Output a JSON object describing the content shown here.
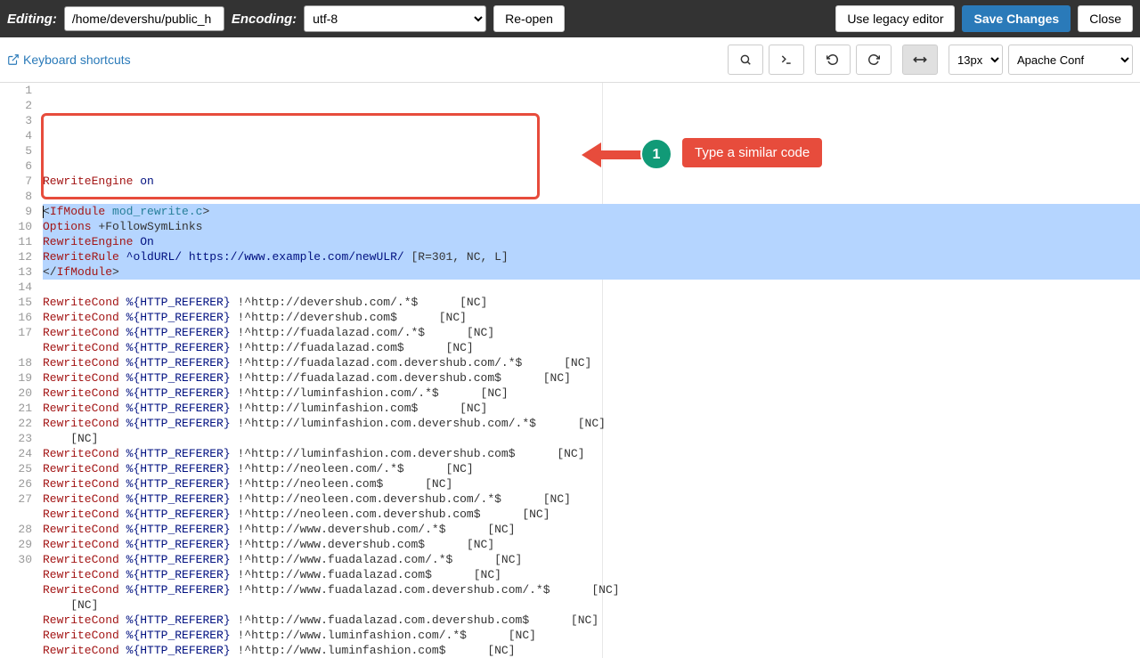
{
  "topbar": {
    "editing_label": "Editing:",
    "path": "/home/devershu/public_h",
    "encoding_label": "Encoding:",
    "encoding_value": "utf-8",
    "reopen": "Re-open",
    "legacy": "Use legacy editor",
    "save": "Save Changes",
    "close": "Close"
  },
  "toolbar": {
    "shortcuts": "Keyboard shortcuts",
    "fontsize": "13px",
    "syntax": "Apache Conf"
  },
  "annotation": {
    "number": "1",
    "text": "Type a similar code"
  },
  "code": {
    "lines": [
      {
        "n": 1,
        "sel": false,
        "tokens": [
          [
            "kw",
            "RewriteEngine"
          ],
          [
            "txt",
            " "
          ],
          [
            "val",
            "on"
          ]
        ]
      },
      {
        "n": 2,
        "sel": false,
        "tokens": []
      },
      {
        "n": 3,
        "sel": true,
        "tokens": [
          [
            "txt",
            "<"
          ],
          [
            "kw",
            "IfModule"
          ],
          [
            "txt",
            " "
          ],
          [
            "func",
            "mod_rewrite.c"
          ],
          [
            "txt",
            ">"
          ]
        ],
        "cursor": true
      },
      {
        "n": 4,
        "sel": true,
        "tokens": [
          [
            "kw",
            "Options"
          ],
          [
            "txt",
            " +FollowSymLinks"
          ]
        ]
      },
      {
        "n": 5,
        "sel": true,
        "tokens": [
          [
            "kw",
            "RewriteEngine"
          ],
          [
            "txt",
            " "
          ],
          [
            "val",
            "On"
          ]
        ]
      },
      {
        "n": 6,
        "sel": true,
        "tokens": [
          [
            "kw",
            "RewriteRule"
          ],
          [
            "txt",
            " "
          ],
          [
            "val",
            "^oldURL/ https://www.example.com/newULR/"
          ],
          [
            "txt",
            " [R=301, NC, L]"
          ]
        ]
      },
      {
        "n": 7,
        "sel": true,
        "tokens": [
          [
            "txt",
            "</"
          ],
          [
            "kw",
            "IfModule"
          ],
          [
            "txt",
            ">"
          ]
        ]
      },
      {
        "n": 8,
        "sel": false,
        "tokens": []
      },
      {
        "n": 9,
        "sel": false,
        "tokens": [
          [
            "kw",
            "RewriteCond"
          ],
          [
            "txt",
            " "
          ],
          [
            "val",
            "%{HTTP_REFERER}"
          ],
          [
            "txt",
            " !^http://devershub.com/.*$      [NC]"
          ]
        ]
      },
      {
        "n": 10,
        "sel": false,
        "tokens": [
          [
            "kw",
            "RewriteCond"
          ],
          [
            "txt",
            " "
          ],
          [
            "val",
            "%{HTTP_REFERER}"
          ],
          [
            "txt",
            " !^http://devershub.com$      [NC]"
          ]
        ]
      },
      {
        "n": 11,
        "sel": false,
        "tokens": [
          [
            "kw",
            "RewriteCond"
          ],
          [
            "txt",
            " "
          ],
          [
            "val",
            "%{HTTP_REFERER}"
          ],
          [
            "txt",
            " !^http://fuadalazad.com/.*$      [NC]"
          ]
        ]
      },
      {
        "n": 12,
        "sel": false,
        "tokens": [
          [
            "kw",
            "RewriteCond"
          ],
          [
            "txt",
            " "
          ],
          [
            "val",
            "%{HTTP_REFERER}"
          ],
          [
            "txt",
            " !^http://fuadalazad.com$      [NC]"
          ]
        ]
      },
      {
        "n": 13,
        "sel": false,
        "tokens": [
          [
            "kw",
            "RewriteCond"
          ],
          [
            "txt",
            " "
          ],
          [
            "val",
            "%{HTTP_REFERER}"
          ],
          [
            "txt",
            " !^http://fuadalazad.com.devershub.com/.*$      [NC]"
          ]
        ]
      },
      {
        "n": 14,
        "sel": false,
        "tokens": [
          [
            "kw",
            "RewriteCond"
          ],
          [
            "txt",
            " "
          ],
          [
            "val",
            "%{HTTP_REFERER}"
          ],
          [
            "txt",
            " !^http://fuadalazad.com.devershub.com$      [NC]"
          ]
        ]
      },
      {
        "n": 15,
        "sel": false,
        "tokens": [
          [
            "kw",
            "RewriteCond"
          ],
          [
            "txt",
            " "
          ],
          [
            "val",
            "%{HTTP_REFERER}"
          ],
          [
            "txt",
            " !^http://luminfashion.com/.*$      [NC]"
          ]
        ]
      },
      {
        "n": 16,
        "sel": false,
        "tokens": [
          [
            "kw",
            "RewriteCond"
          ],
          [
            "txt",
            " "
          ],
          [
            "val",
            "%{HTTP_REFERER}"
          ],
          [
            "txt",
            " !^http://luminfashion.com$      [NC]"
          ]
        ]
      },
      {
        "n": 17,
        "sel": false,
        "tokens": [
          [
            "kw",
            "RewriteCond"
          ],
          [
            "txt",
            " "
          ],
          [
            "val",
            "%{HTTP_REFERER}"
          ],
          [
            "txt",
            " !^http://luminfashion.com.devershub.com/.*$      [NC]"
          ]
        ],
        "wrap": true
      },
      {
        "n": 18,
        "sel": false,
        "tokens": [
          [
            "kw",
            "RewriteCond"
          ],
          [
            "txt",
            " "
          ],
          [
            "val",
            "%{HTTP_REFERER}"
          ],
          [
            "txt",
            " !^http://luminfashion.com.devershub.com$      [NC]"
          ]
        ]
      },
      {
        "n": 19,
        "sel": false,
        "tokens": [
          [
            "kw",
            "RewriteCond"
          ],
          [
            "txt",
            " "
          ],
          [
            "val",
            "%{HTTP_REFERER}"
          ],
          [
            "txt",
            " !^http://neoleen.com/.*$      [NC]"
          ]
        ]
      },
      {
        "n": 20,
        "sel": false,
        "tokens": [
          [
            "kw",
            "RewriteCond"
          ],
          [
            "txt",
            " "
          ],
          [
            "val",
            "%{HTTP_REFERER}"
          ],
          [
            "txt",
            " !^http://neoleen.com$      [NC]"
          ]
        ]
      },
      {
        "n": 21,
        "sel": false,
        "tokens": [
          [
            "kw",
            "RewriteCond"
          ],
          [
            "txt",
            " "
          ],
          [
            "val",
            "%{HTTP_REFERER}"
          ],
          [
            "txt",
            " !^http://neoleen.com.devershub.com/.*$      [NC]"
          ]
        ]
      },
      {
        "n": 22,
        "sel": false,
        "tokens": [
          [
            "kw",
            "RewriteCond"
          ],
          [
            "txt",
            " "
          ],
          [
            "val",
            "%{HTTP_REFERER}"
          ],
          [
            "txt",
            " !^http://neoleen.com.devershub.com$      [NC]"
          ]
        ]
      },
      {
        "n": 23,
        "sel": false,
        "tokens": [
          [
            "kw",
            "RewriteCond"
          ],
          [
            "txt",
            " "
          ],
          [
            "val",
            "%{HTTP_REFERER}"
          ],
          [
            "txt",
            " !^http://www.devershub.com/.*$      [NC]"
          ]
        ]
      },
      {
        "n": 24,
        "sel": false,
        "tokens": [
          [
            "kw",
            "RewriteCond"
          ],
          [
            "txt",
            " "
          ],
          [
            "val",
            "%{HTTP_REFERER}"
          ],
          [
            "txt",
            " !^http://www.devershub.com$      [NC]"
          ]
        ]
      },
      {
        "n": 25,
        "sel": false,
        "tokens": [
          [
            "kw",
            "RewriteCond"
          ],
          [
            "txt",
            " "
          ],
          [
            "val",
            "%{HTTP_REFERER}"
          ],
          [
            "txt",
            " !^http://www.fuadalazad.com/.*$      [NC]"
          ]
        ]
      },
      {
        "n": 26,
        "sel": false,
        "tokens": [
          [
            "kw",
            "RewriteCond"
          ],
          [
            "txt",
            " "
          ],
          [
            "val",
            "%{HTTP_REFERER}"
          ],
          [
            "txt",
            " !^http://www.fuadalazad.com$      [NC]"
          ]
        ]
      },
      {
        "n": 27,
        "sel": false,
        "tokens": [
          [
            "kw",
            "RewriteCond"
          ],
          [
            "txt",
            " "
          ],
          [
            "val",
            "%{HTTP_REFERER}"
          ],
          [
            "txt",
            " !^http://www.fuadalazad.com.devershub.com/.*$      [NC]"
          ]
        ],
        "wrap": true
      },
      {
        "n": 28,
        "sel": false,
        "tokens": [
          [
            "kw",
            "RewriteCond"
          ],
          [
            "txt",
            " "
          ],
          [
            "val",
            "%{HTTP_REFERER}"
          ],
          [
            "txt",
            " !^http://www.fuadalazad.com.devershub.com$      [NC]"
          ]
        ]
      },
      {
        "n": 29,
        "sel": false,
        "tokens": [
          [
            "kw",
            "RewriteCond"
          ],
          [
            "txt",
            " "
          ],
          [
            "val",
            "%{HTTP_REFERER}"
          ],
          [
            "txt",
            " !^http://www.luminfashion.com/.*$      [NC]"
          ]
        ]
      },
      {
        "n": 30,
        "sel": false,
        "tokens": [
          [
            "kw",
            "RewriteCond"
          ],
          [
            "txt",
            " "
          ],
          [
            "val",
            "%{HTTP_REFERER}"
          ],
          [
            "txt",
            " !^http://www.luminfashion.com$      [NC]"
          ]
        ]
      }
    ],
    "wrap_tail": "[NC]"
  }
}
